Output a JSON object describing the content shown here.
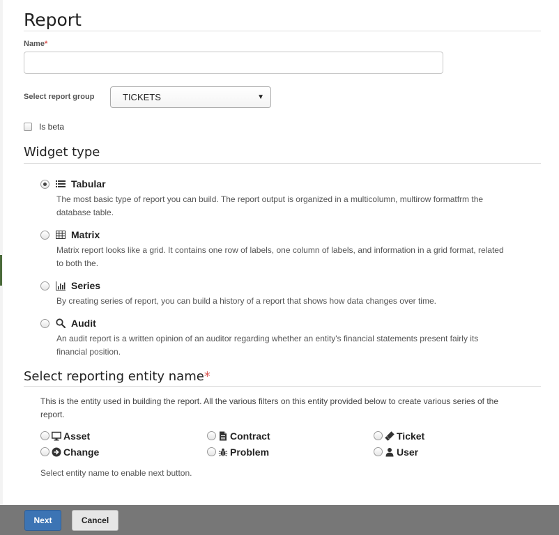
{
  "page": {
    "title": "Report"
  },
  "form": {
    "name_label": "Name",
    "required_mark": "*",
    "name_value": "",
    "group_label": "Select report group",
    "group_value": "TICKETS",
    "beta_label": "Is beta",
    "beta_checked": false
  },
  "widget_type": {
    "heading": "Widget type",
    "options": [
      {
        "label": "Tabular",
        "icon": "list-icon",
        "selected": true,
        "description": "The most basic type of report you can build. The report output is organized in a multicolumn, multirow formatfrm the database table."
      },
      {
        "label": "Matrix",
        "icon": "table-grid-icon",
        "selected": false,
        "description": "Matrix report looks like a grid. It contains one row of labels, one column of labels, and information in a grid format, related to both the."
      },
      {
        "label": "Series",
        "icon": "bar-chart-icon",
        "selected": false,
        "description": "By creating series of report, you can build a history of a report that shows how data changes over time."
      },
      {
        "label": "Audit",
        "icon": "search-icon",
        "selected": false,
        "description": "An audit report is a written opinion of an auditor regarding whether an entity's financial statements present fairly its financial position."
      }
    ]
  },
  "entity": {
    "heading": "Select reporting entity name",
    "required_mark": "*",
    "description": "This is the entity used in building the report. All the various filters on this entity provided below to create various series of the report.",
    "options": [
      {
        "label": "Asset",
        "icon": "monitor-icon"
      },
      {
        "label": "Contract",
        "icon": "document-icon"
      },
      {
        "label": "Ticket",
        "icon": "ticket-icon"
      },
      {
        "label": "Change",
        "icon": "arrow-circle-icon"
      },
      {
        "label": "Problem",
        "icon": "bug-icon"
      },
      {
        "label": "User",
        "icon": "user-icon"
      }
    ],
    "hint": "Select entity name to enable next button."
  },
  "footer": {
    "next_label": "Next",
    "cancel_label": "Cancel"
  },
  "colors": {
    "primary": "#3c74b4",
    "required": "#d9534f",
    "footer": "#777777"
  }
}
